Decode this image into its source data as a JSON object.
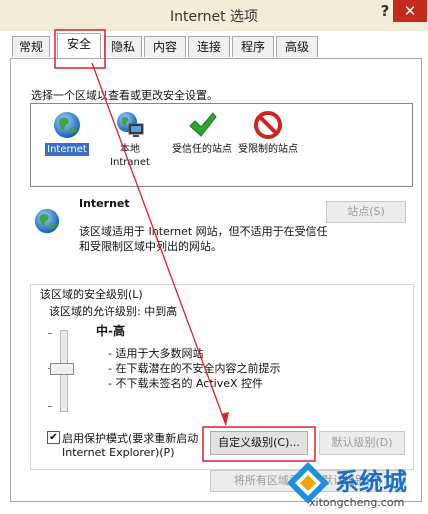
{
  "window": {
    "title": "Internet 选项",
    "help_glyph": "?",
    "close_glyph": "✕"
  },
  "tabs": [
    {
      "label": "常规",
      "active": false
    },
    {
      "label": "安全",
      "active": true
    },
    {
      "label": "隐私",
      "active": false
    },
    {
      "label": "内容",
      "active": false
    },
    {
      "label": "连接",
      "active": false
    },
    {
      "label": "程序",
      "active": false
    },
    {
      "label": "高级",
      "active": false
    }
  ],
  "security": {
    "instruction": "选择一个区域以查看或更改安全设置。",
    "zones": [
      {
        "label": "Internet",
        "icon": "globe-icon",
        "selected": true
      },
      {
        "label": "本地 Intranet",
        "icon": "local-intranet-icon",
        "selected": false
      },
      {
        "label": "受信任的站点",
        "icon": "checkmark-icon",
        "selected": false
      },
      {
        "label": "受限制的站点",
        "icon": "prohibited-icon",
        "selected": false
      }
    ],
    "zone_title": "Internet",
    "zone_description_line1": "该区域适用于 Internet 网站，但不适用于在受信任",
    "zone_description_line2": "和受限制区域中列出的网站。",
    "sites_button": "站点(S)",
    "level_group_label": "该区域的安全级别(L)",
    "allowed_levels": "该区域的允许级别: 中到高",
    "level_name": "中-高",
    "level_bullets": [
      "- 适用于大多数网站",
      "- 在下载潜在的不安全内容之前提示",
      "- 不下载未签名的 ActiveX 控件"
    ],
    "protected_mode_line1": "启用保护模式(要求重新启动",
    "protected_mode_line2": "Internet Explorer)(P)",
    "protected_mode_checked": true,
    "custom_level_button": "自定义级别(C)...",
    "default_level_button": "默认级别(D)",
    "reset_all_button": "将所有区域重置为默认级别(R)"
  },
  "watermark": {
    "brand": "系统城",
    "url": "xitongcheng.com"
  },
  "colors": {
    "annotation_red": "#d8232a",
    "selection_blue": "#3a6fc4",
    "titlebar": "#f2ecd8"
  }
}
